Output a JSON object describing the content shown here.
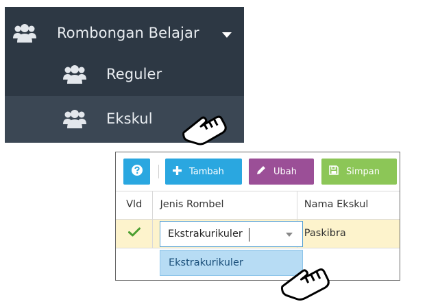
{
  "sidebar": {
    "parent_item": {
      "label": "Rombongan Belajar",
      "icon": "users-icon",
      "caret": "caret-down-icon"
    },
    "children": [
      {
        "label": "Reguler",
        "icon": "users-icon"
      },
      {
        "label": "Ekskul",
        "icon": "users-icon",
        "state": "hovered"
      }
    ],
    "colors": {
      "background": "#2d3844",
      "hover": "#3b4754",
      "text": "#e9edf1"
    }
  },
  "toolbar": {
    "help_icon": "question-circle-icon",
    "add_label": "Tambah",
    "edit_label": "Ubah",
    "save_label": "Simpan",
    "colors": {
      "add": "#2aa7e0",
      "edit": "#9b4f97",
      "save": "#8cc657"
    }
  },
  "grid": {
    "columns": [
      "Vld",
      "Jenis Rombel",
      "Nama Ekskul"
    ],
    "rows": [
      {
        "vld": "check-icon",
        "jenis_rombel": "Ekstrakurikuler",
        "nama_ekskul": "Paskibra",
        "selected": true
      }
    ],
    "editor": {
      "value": "Ekstrakurikuler",
      "options": [
        "Ekstrakurikuler"
      ]
    }
  }
}
